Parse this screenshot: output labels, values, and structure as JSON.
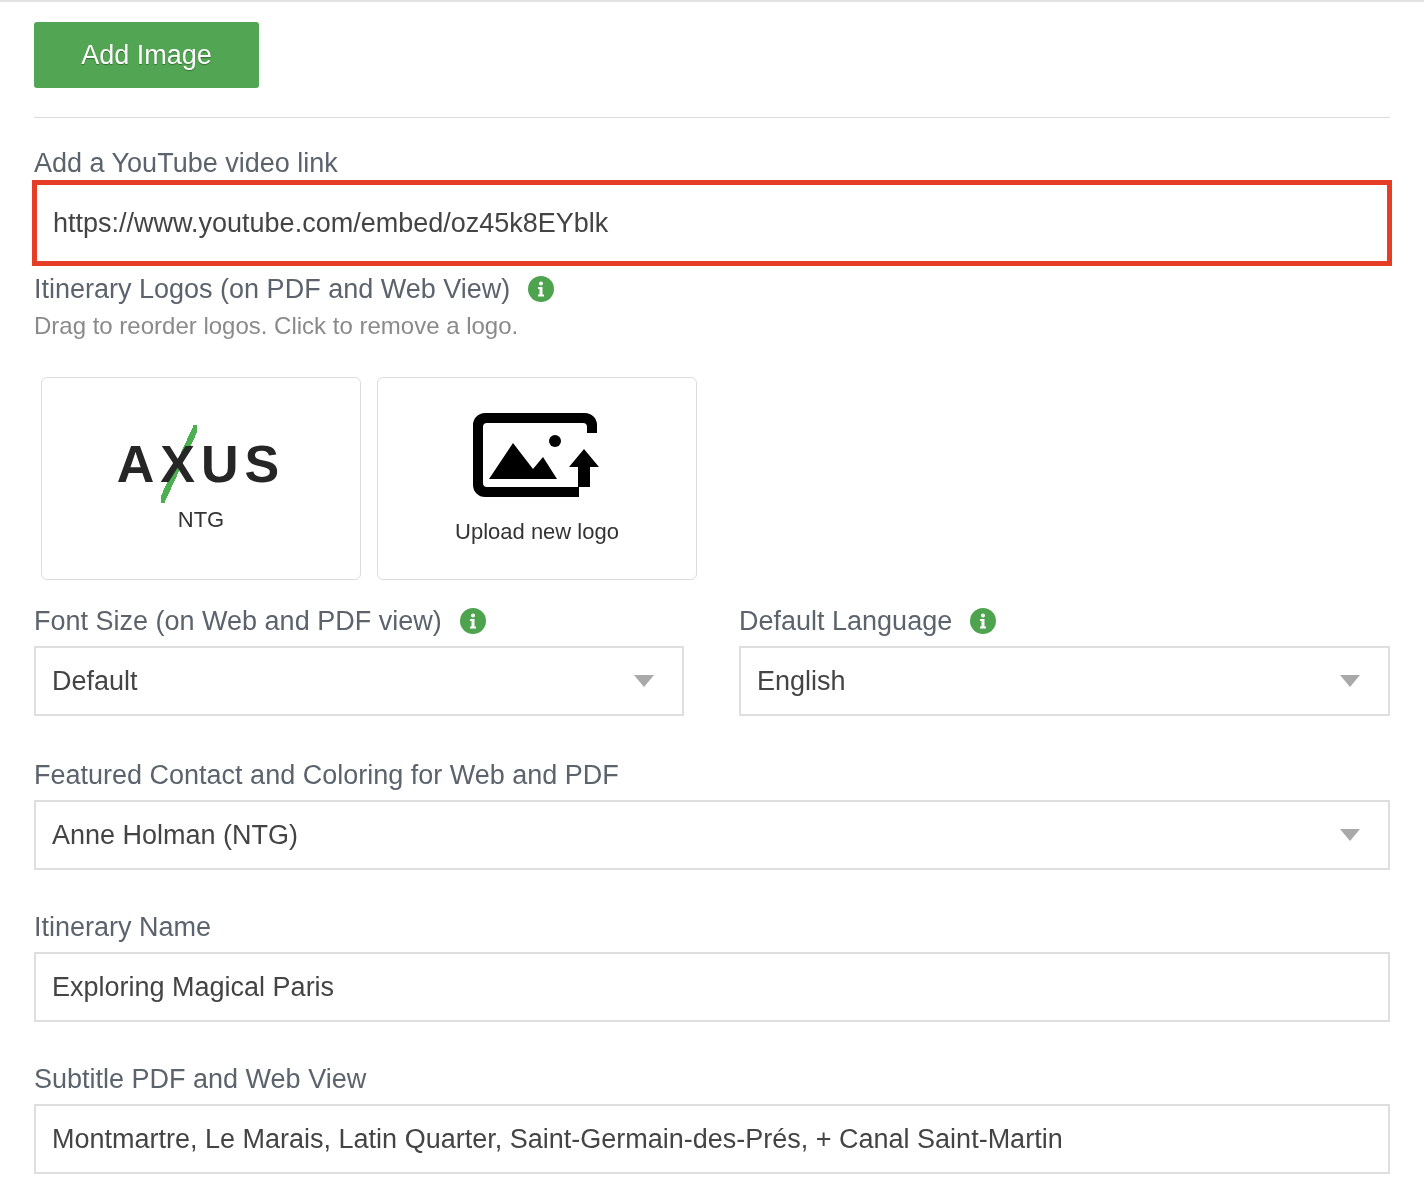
{
  "add_image_button": "Add Image",
  "youtube": {
    "label": "Add a YouTube video link",
    "value": "https://www.youtube.com/embed/oz45k8EYblk",
    "highlighted": true
  },
  "logos_section": {
    "label": "Itinerary Logos (on PDF and Web View)",
    "info": true,
    "hint": "Drag to reorder logos. Click to remove a logo.",
    "logos": [
      {
        "kind": "logo",
        "logo_text": "AXUS",
        "caption": "NTG"
      },
      {
        "kind": "upload",
        "caption": "Upload new logo"
      }
    ]
  },
  "selects": [
    {
      "label": "Font Size (on Web and PDF view)",
      "info": true,
      "value": "Default"
    },
    {
      "label": "Default Language",
      "info": true,
      "value": "English"
    }
  ],
  "featured": {
    "label": "Featured Contact and Coloring for Web and PDF",
    "value": "Anne Holman (NTG)"
  },
  "fields": [
    {
      "label": "Itinerary Name",
      "value": "Exploring Magical Paris"
    },
    {
      "label": "Subtitle PDF and Web View",
      "value": "Montmartre, Le Marais, Latin Quarter, Saint-Germain-des-Prés, + Canal Saint-Martin"
    }
  ]
}
